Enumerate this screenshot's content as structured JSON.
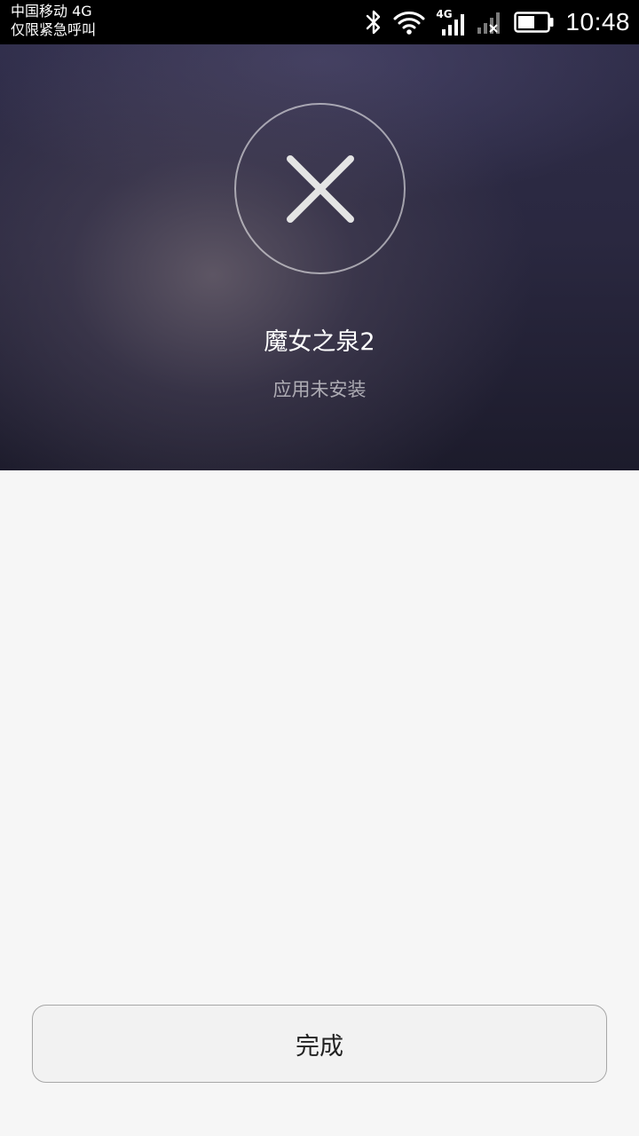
{
  "status_bar": {
    "carrier_line1": "中国移动 4G",
    "carrier_line2": "仅限紧急呼叫",
    "network_type": "4G",
    "time": "10:48",
    "icons": [
      "bluetooth-icon",
      "wifi-icon",
      "cell-signal-icon",
      "no-sim-signal-icon",
      "battery-icon"
    ],
    "battery_level": 0.5
  },
  "hero": {
    "status_icon": "close-icon",
    "app_name": "魔女之泉2",
    "status_text": "应用未安装"
  },
  "actions": {
    "done_label": "完成"
  },
  "colors": {
    "status_bar_bg": "#000000",
    "hero_bg": "#2a2840",
    "page_bg": "#f6f6f6",
    "button_bg": "#f2f2f2",
    "button_border": "#a7a7a7"
  }
}
